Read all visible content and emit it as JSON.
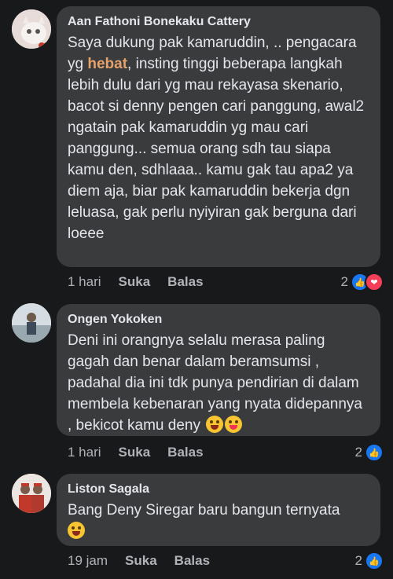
{
  "comments": [
    {
      "author": "Aan Fathoni Bonekaku Cattery",
      "text_before": "Saya dukung pak kamaruddin, .. pengacara yg ",
      "text_highlight": "hebat",
      "text_after": ", insting tinggi beberapa langkah lebih dulu dari yg mau rekayasa skenario, bacot si denny pengen cari panggung, awal2 ngatain pak kamaruddin yg mau cari panggung... semua orang sdh tau siapa kamu den, sdhlaaa.. kamu gak tau apa2 ya diem aja, biar pak kamaruddin bekerja dgn leluasa, gak perlu nyiyiran gak berguna dari loeee",
      "time": "1 hari",
      "like_label": "Suka",
      "reply_label": "Balas",
      "reaction_count": "2",
      "reactions": [
        "like-icon",
        "love-icon"
      ]
    },
    {
      "author": "Ongen Yokoken",
      "text": "Deni ini orangnya selalu merasa paling gagah dan benar dalam beramsumsi , padahal dia ini tdk punya pendirian di dalam membela kebenaran yang nyata didepannya , bekicot kamu deny",
      "time": "1 hari",
      "like_label": "Suka",
      "reply_label": "Balas",
      "reaction_count": "2",
      "reactions": [
        "like-icon"
      ],
      "emojis": [
        "laughing-emoji",
        "tongue-emoji"
      ]
    },
    {
      "author": "Liston Sagala",
      "text": "Bang Deny Siregar baru bangun ternyata",
      "time": "19 jam",
      "like_label": "Suka",
      "reply_label": "Balas",
      "reaction_count": "2",
      "reactions": [
        "like-icon"
      ],
      "emojis": [
        "tears-of-joy-emoji"
      ]
    }
  ],
  "colors": {
    "background": "#18191a",
    "bubble": "#3a3b3c",
    "highlight": "#e6a26b",
    "like": "#1877f2",
    "love": "#f33e58"
  }
}
